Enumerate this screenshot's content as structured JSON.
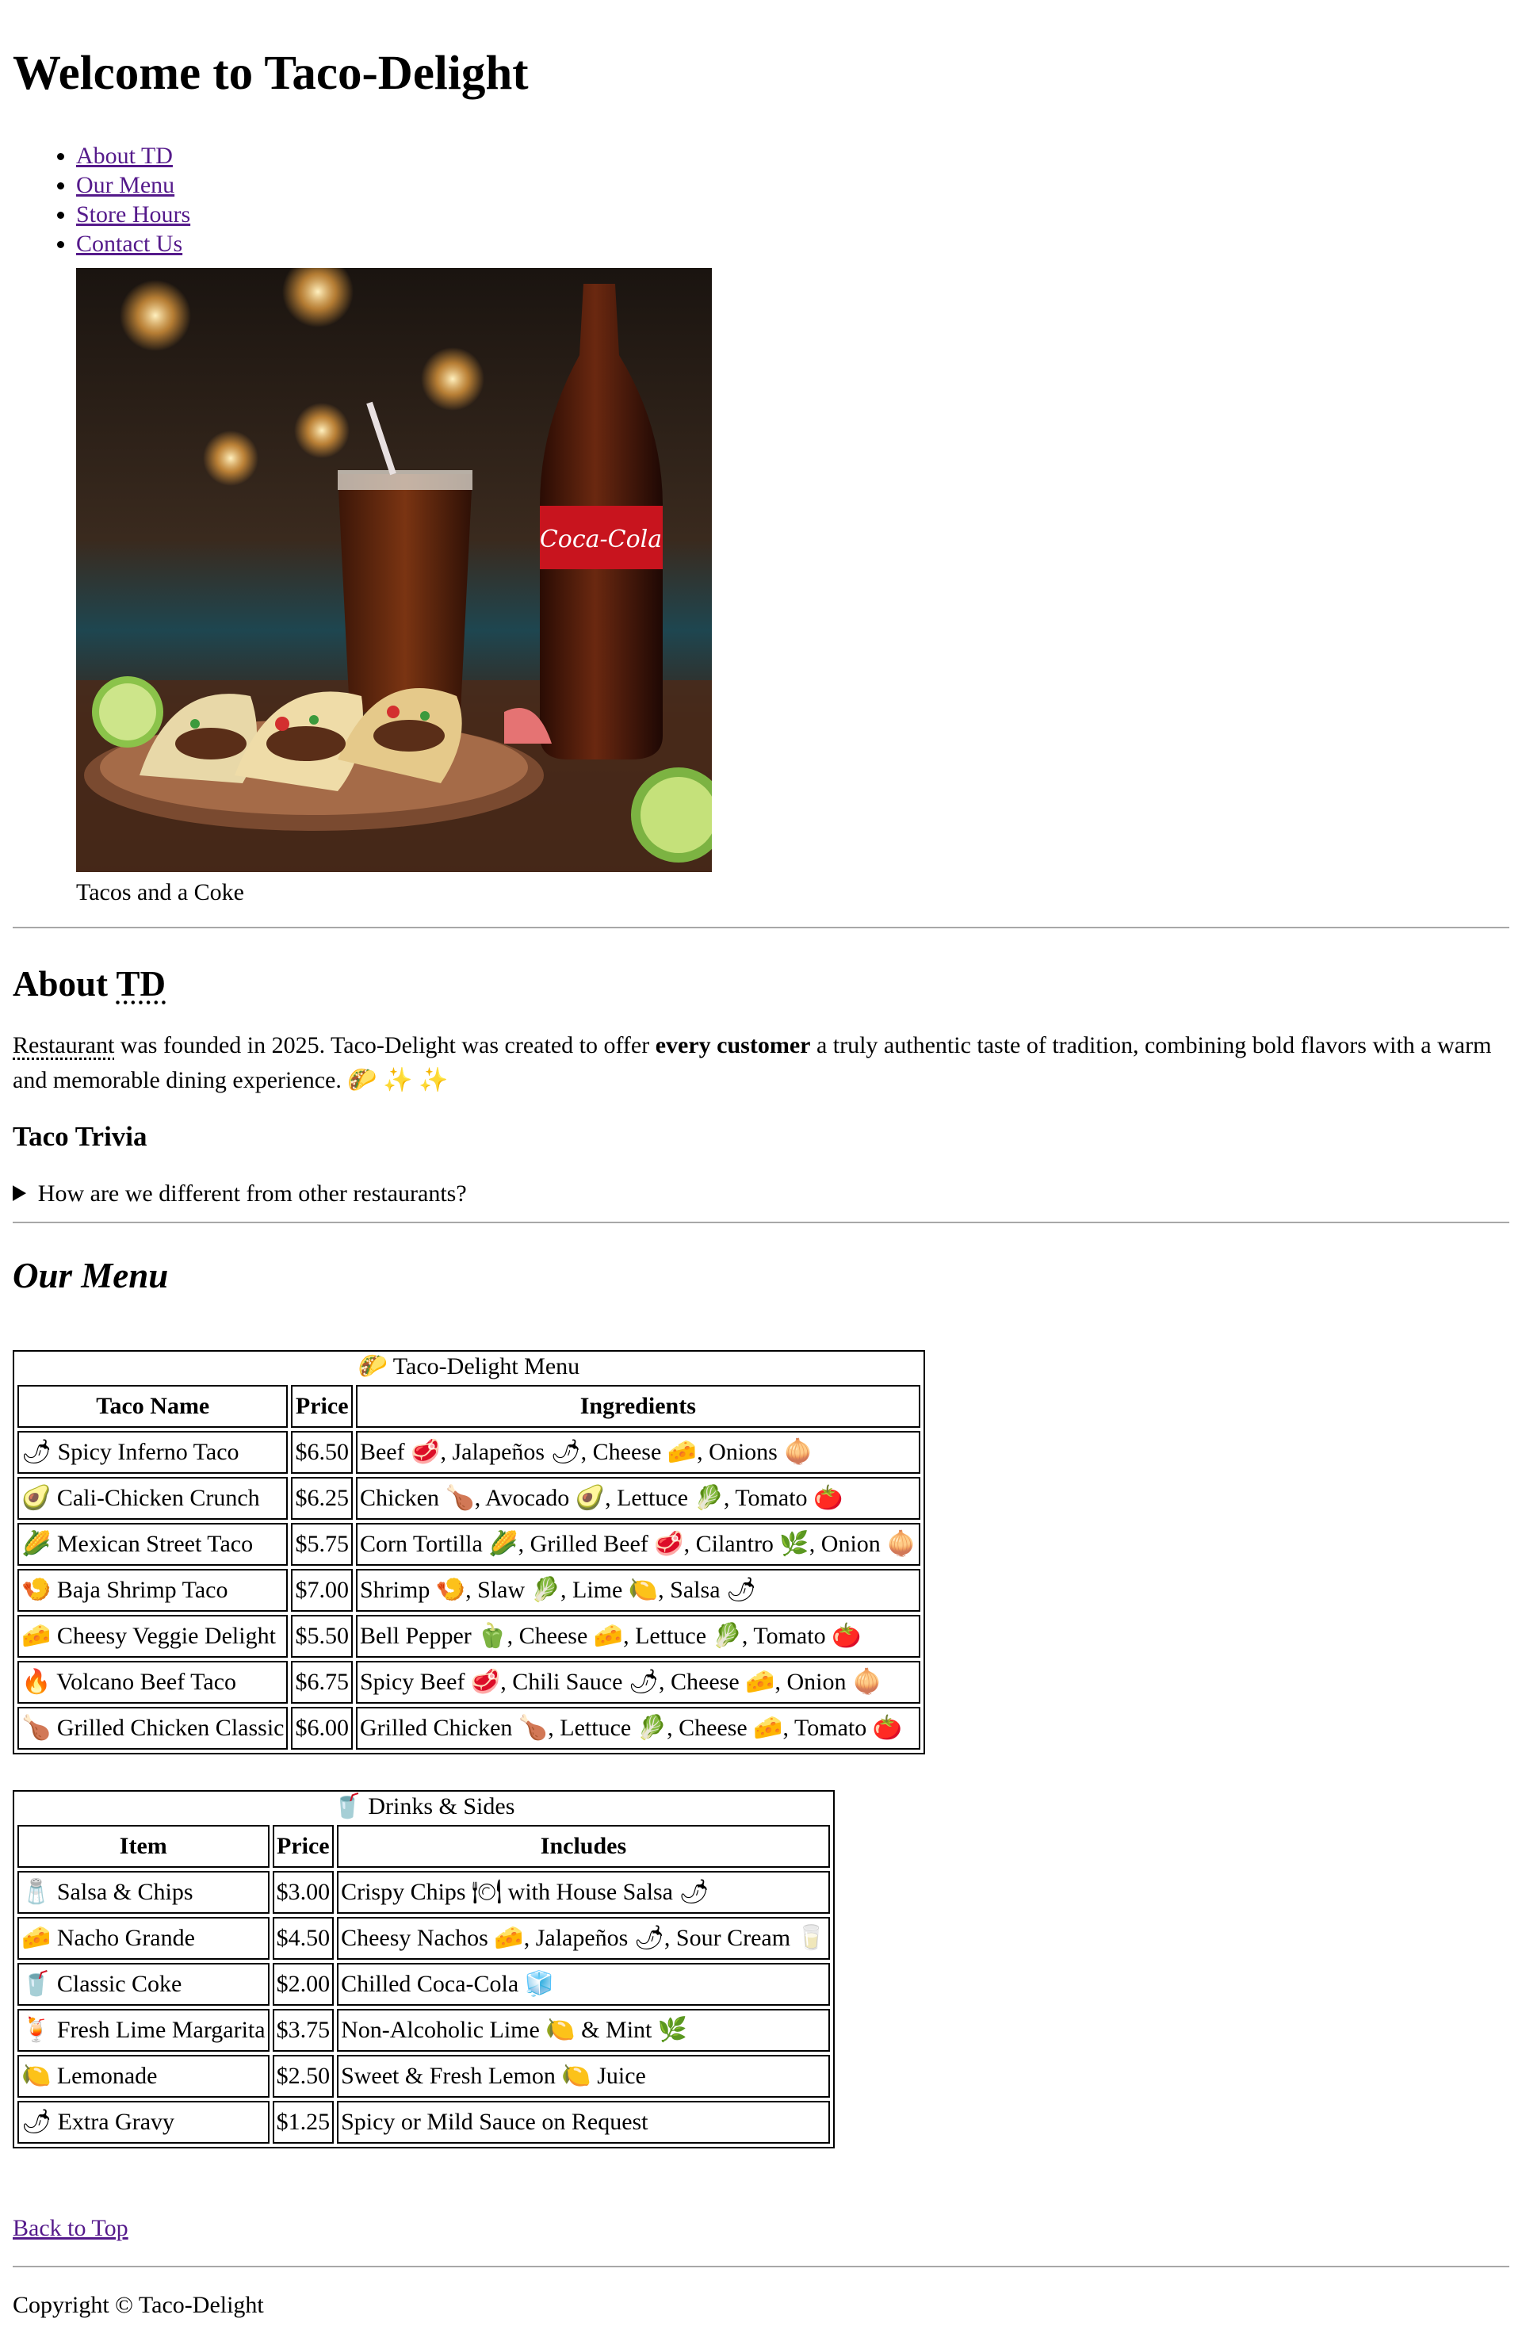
{
  "header": {
    "title": "Welcome to Taco-Delight"
  },
  "nav": [
    "About TD",
    "Our Menu",
    "Store Hours",
    "Contact Us"
  ],
  "hero": {
    "caption": "Tacos and a Coke"
  },
  "about": {
    "heading_prefix": "About",
    "heading_abbr": "TD",
    "abbr_word": "Restaurant",
    "text_1": " was founded in 2025. Taco-Delight was created to offer ",
    "bold": "every customer",
    "text_2": " a truly authentic taste of tradition, combining bold flavors with a warm and memorable dining experience. 🌮 ✨ ✨",
    "trivia_heading": "Taco Trivia",
    "trivia_summary": "How are we different from other restaurants?"
  },
  "menu": {
    "heading": "Our Menu",
    "taco_caption": "🌮 Taco-Delight Menu",
    "taco_headers": [
      "Taco Name",
      "Price",
      "Ingredients"
    ],
    "tacos": [
      [
        "🌶 Spicy Inferno Taco",
        "$6.50",
        "Beef 🥩, Jalapeños 🌶, Cheese 🧀, Onions 🧅"
      ],
      [
        "🥑 Cali-Chicken Crunch",
        "$6.25",
        "Chicken 🍗, Avocado 🥑, Lettuce 🥬, Tomato 🍅"
      ],
      [
        "🌽 Mexican Street Taco",
        "$5.75",
        "Corn Tortilla 🌽, Grilled Beef 🥩, Cilantro 🌿, Onion 🧅"
      ],
      [
        "🍤 Baja Shrimp Taco",
        "$7.00",
        "Shrimp 🍤, Slaw 🥬, Lime 🍋, Salsa 🌶"
      ],
      [
        "🧀 Cheesy Veggie Delight",
        "$5.50",
        "Bell Pepper 🫑, Cheese 🧀, Lettuce 🥬, Tomato 🍅"
      ],
      [
        "🔥 Volcano Beef Taco",
        "$6.75",
        "Spicy Beef 🥩, Chili Sauce 🌶, Cheese 🧀, Onion 🧅"
      ],
      [
        "🍗 Grilled Chicken Classic",
        "$6.00",
        "Grilled Chicken 🍗, Lettuce 🥬, Cheese 🧀, Tomato 🍅"
      ]
    ],
    "drinks_caption": "🥤 Drinks & Sides",
    "drinks_headers": [
      "Item",
      "Price",
      "Includes"
    ],
    "drinks": [
      [
        "🧂 Salsa & Chips",
        "$3.00",
        "Crispy Chips 🍽 with House Salsa 🌶"
      ],
      [
        "🧀 Nacho Grande",
        "$4.50",
        "Cheesy Nachos 🧀, Jalapeños 🌶, Sour Cream 🥛"
      ],
      [
        "🥤 Classic Coke",
        "$2.00",
        "Chilled Coca-Cola 🧊"
      ],
      [
        "🍹 Fresh Lime Margarita",
        "$3.75",
        "Non-Alcoholic Lime 🍋 & Mint 🌿"
      ],
      [
        "🍋 Lemonade",
        "$2.50",
        "Sweet & Fresh Lemon 🍋 Juice"
      ],
      [
        "🌶 Extra Gravy",
        "$1.25",
        "Spicy or Mild Sauce on Request"
      ]
    ]
  },
  "footer": {
    "back_to_top": "Back to Top",
    "copyright": "Copyright © Taco-Delight"
  }
}
